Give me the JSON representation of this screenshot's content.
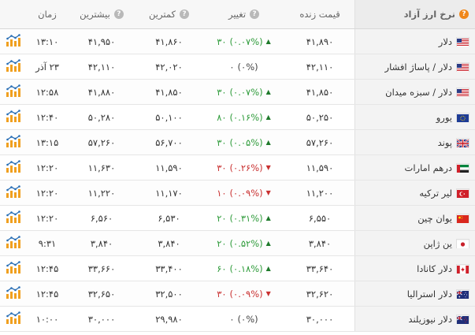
{
  "header": {
    "name": "نرخ ارز آزاد",
    "price": "قیمت زنده",
    "change": "تغییر",
    "low": "کمترین",
    "high": "بیشترین",
    "time": "زمان"
  },
  "colors": {
    "up": "#2e9b3a",
    "down": "#c93030",
    "accent": "#f0871a"
  },
  "rows": [
    {
      "name": "دلار",
      "flag": "us",
      "price": "۴۱,۸۹۰",
      "dir": "up",
      "change_pct": "(۰.۰۷%)",
      "change_abs": "۳۰",
      "low": "۴۱,۸۶۰",
      "high": "۴۱,۹۵۰",
      "time": "۱۳:۱۰"
    },
    {
      "name": "دلار / پاساژ افشار",
      "flag": "us",
      "price": "۴۲,۱۱۰",
      "dir": "flat",
      "change_pct": "(۰%)",
      "change_abs": "۰",
      "low": "۴۲,۰۲۰",
      "high": "۴۲,۱۱۰",
      "time": "۲۳ آذر"
    },
    {
      "name": "دلار / سبزه میدان",
      "flag": "us",
      "price": "۴۱,۸۵۰",
      "dir": "up",
      "change_pct": "(۰.۰۷%)",
      "change_abs": "۳۰",
      "low": "۴۱,۸۵۰",
      "high": "۴۱,۸۸۰",
      "time": "۱۲:۵۸"
    },
    {
      "name": "یورو",
      "flag": "eu",
      "price": "۵۰,۲۵۰",
      "dir": "up",
      "change_pct": "(۰.۱۶%)",
      "change_abs": "۸۰",
      "low": "۵۰,۱۰۰",
      "high": "۵۰,۲۸۰",
      "time": "۱۲:۴۰"
    },
    {
      "name": "پوند",
      "flag": "uk",
      "price": "۵۷,۲۶۰",
      "dir": "up",
      "change_pct": "(۰.۰۵%)",
      "change_abs": "۳۰",
      "low": "۵۶,۷۰۰",
      "high": "۵۷,۲۶۰",
      "time": "۱۳:۱۵"
    },
    {
      "name": "درهم امارات",
      "flag": "ae",
      "price": "۱۱,۵۹۰",
      "dir": "down",
      "change_pct": "(۰.۲۶%)",
      "change_abs": "۳۰",
      "low": "۱۱,۵۹۰",
      "high": "۱۱,۶۳۰",
      "time": "۱۲:۲۰"
    },
    {
      "name": "لیر ترکیه",
      "flag": "tr",
      "price": "۱۱,۲۰۰",
      "dir": "down",
      "change_pct": "(۰.۰۹%)",
      "change_abs": "۱۰",
      "low": "۱۱,۱۷۰",
      "high": "۱۱,۲۲۰",
      "time": "۱۲:۲۰"
    },
    {
      "name": "یوان چین",
      "flag": "cn",
      "price": "۶,۵۵۰",
      "dir": "up",
      "change_pct": "(۰.۳۱%)",
      "change_abs": "۲۰",
      "low": "۶,۵۳۰",
      "high": "۶,۵۶۰",
      "time": "۱۲:۲۰"
    },
    {
      "name": "ین ژاپن",
      "flag": "jp",
      "price": "۳,۸۴۰",
      "dir": "up",
      "change_pct": "(۰.۵۲%)",
      "change_abs": "۲۰",
      "low": "۳,۸۴۰",
      "high": "۳,۸۴۰",
      "time": "۹:۳۱"
    },
    {
      "name": "دلار کانادا",
      "flag": "ca",
      "price": "۳۳,۶۴۰",
      "dir": "up",
      "change_pct": "(۰.۱۸%)",
      "change_abs": "۶۰",
      "low": "۳۳,۴۰۰",
      "high": "۳۳,۶۶۰",
      "time": "۱۲:۴۵"
    },
    {
      "name": "دلار استرالیا",
      "flag": "au",
      "price": "۳۲,۶۲۰",
      "dir": "down",
      "change_pct": "(۰.۰۹%)",
      "change_abs": "۳۰",
      "low": "۳۲,۵۰۰",
      "high": "۳۲,۶۵۰",
      "time": "۱۲:۴۵"
    },
    {
      "name": "دلار نیوزیلند",
      "flag": "nz",
      "price": "۳۰,۰۰۰",
      "dir": "flat",
      "change_pct": "(۰%)",
      "change_abs": "۰",
      "low": "۲۹,۹۸۰",
      "high": "۳۰,۰۰۰",
      "time": "۱۰:۰۰"
    }
  ]
}
